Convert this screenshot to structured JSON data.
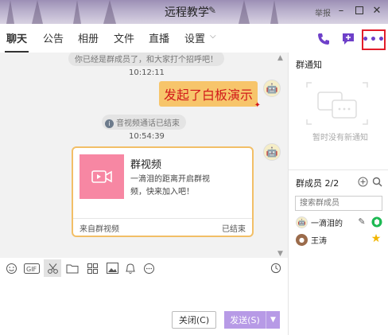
{
  "window": {
    "title": "远程教学",
    "report_label": "举报",
    "controls": [
      "minimize",
      "maximize",
      "close"
    ]
  },
  "tabs": [
    "聊天",
    "公告",
    "相册",
    "文件",
    "直播",
    "设置"
  ],
  "active_tab": "聊天",
  "header_actions": [
    "phone-icon",
    "add-message-icon",
    "more-icon"
  ],
  "chat": {
    "top_notice": "你已经是群成员了，和大家打个招呼吧！",
    "time_1": "10:12:11",
    "whiteboard_message": "发起了白板演示",
    "system_notice": "音视频通话已结束",
    "time_2": "10:54:39",
    "card": {
      "title": "群视频",
      "description": "一滴泪的距离开启群视频，快来加入吧！",
      "source": "来自群视频",
      "status": "已结束"
    }
  },
  "toolbar": [
    "emoji-icon",
    "gif-icon",
    "scissors-icon",
    "folder-icon",
    "apps-icon",
    "image-icon",
    "bell-icon",
    "more-circle-icon",
    "history-icon"
  ],
  "buttons": {
    "close": "关闭(C)",
    "send": "发送(S)"
  },
  "notice_panel": {
    "title": "群通知",
    "empty": "暂时没有新通知"
  },
  "members_panel": {
    "title": "群成员 2/2",
    "search_placeholder": "搜索群成员",
    "members": [
      {
        "name": "一滴泪的",
        "badge": "edit-icon"
      },
      {
        "name": "王涛",
        "badge": "star-icon"
      }
    ]
  },
  "colors": {
    "accent": "#6e40c9",
    "highlight": "#e21d2a",
    "card_border": "#f2bf67",
    "whiteboard_bg": "#f7c56b",
    "send_button": "#b79ae6"
  }
}
